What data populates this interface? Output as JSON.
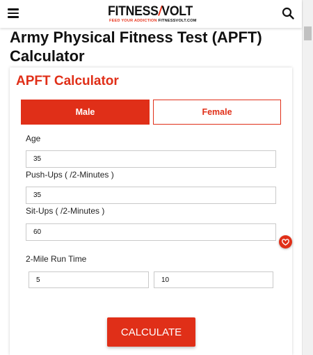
{
  "header": {
    "logo_main_left": "FITNESS",
    "logo_slash": "/",
    "logo_main_right": "VOLT",
    "logo_tagline": "FEED YOUR ADDICTION",
    "logo_site": "FITNESSVOLT.COM"
  },
  "page": {
    "title": "Army Physical Fitness Test (APFT) Calculator"
  },
  "calculator": {
    "title": "APFT Calculator",
    "tabs": [
      {
        "label": "Male",
        "selected": true
      },
      {
        "label": "Female",
        "selected": false
      }
    ],
    "age": {
      "label": "Age",
      "value": "35"
    },
    "pushups": {
      "label": "Push-Ups ( /2-Minutes )",
      "value": "35"
    },
    "situps": {
      "label": "Sit-Ups ( /2-Minutes )",
      "value": "60"
    },
    "run": {
      "label": "2-Mile Run Time",
      "minutes": "5",
      "seconds": "10"
    },
    "button_label": "CALCULATE"
  },
  "icons": {
    "menu": "hamburger-menu-icon",
    "search": "search-icon",
    "favorite": "heart-icon"
  },
  "colors": {
    "accent": "#e02f18",
    "text": "#222222"
  }
}
